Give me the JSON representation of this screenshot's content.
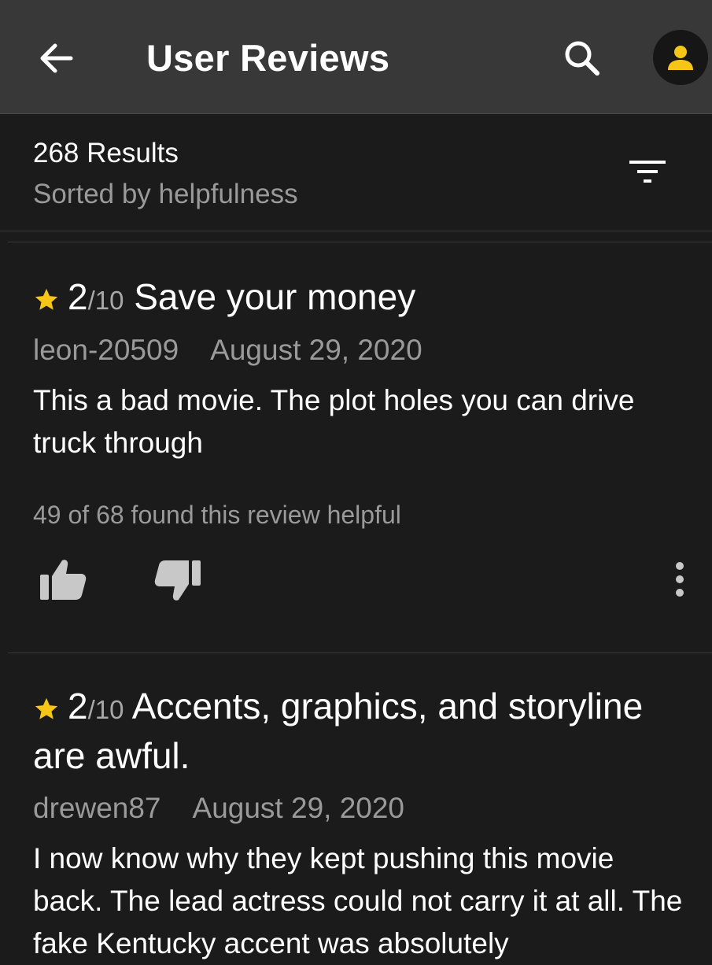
{
  "appbar": {
    "title": "User Reviews",
    "icons": {
      "back": "arrow-left-icon",
      "search": "search-icon",
      "account": "account-icon"
    },
    "accent": "#f5c518"
  },
  "results": {
    "count": "268 Results",
    "sort": "Sorted by helpfulness",
    "filter_icon": "filter-icon"
  },
  "reviews": [
    {
      "rating": "2",
      "rating_max": "/10",
      "title": "Save your money",
      "author": "leon-20509",
      "date": "August 29, 2020",
      "body": "This a bad movie. The plot holes you can drive truck through",
      "helpful": "49 of 68 found this review helpful"
    },
    {
      "rating": "2",
      "rating_max": "/10",
      "title": "Accents, graphics, and storyline are awful.",
      "author": "drewen87",
      "date": "August 29, 2020",
      "body": "I now know why they kept pushing this movie back. The lead actress could not carry it at all. The fake Kentucky accent was absolutely"
    }
  ]
}
